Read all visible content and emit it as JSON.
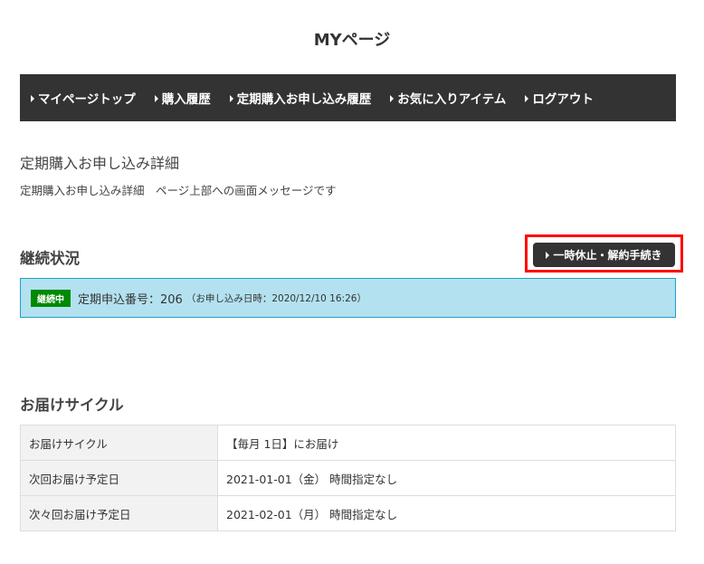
{
  "page_title": "MYページ",
  "nav": [
    "マイページトップ",
    "購入履歴",
    "定期購入お申し込み履歴",
    "お気に入りアイテム",
    "ログアウト"
  ],
  "heading": "定期購入お申し込み詳細",
  "message": "定期購入お申し込み詳細　ページ上部への画面メッセージです",
  "status_section": {
    "title": "継続状況",
    "button": "一時休止・解約手続き",
    "badge": "継続中",
    "order": "定期申込番号：206",
    "order_date": "（お申し込み日時：2020/12/10 16:26）"
  },
  "delivery": {
    "title": "お届けサイクル",
    "rows": [
      {
        "label": "お届けサイクル",
        "value": "【毎月 1日】にお届け"
      },
      {
        "label": "次回お届け予定日",
        "value": "2021-01-01（金） 時間指定なし"
      },
      {
        "label": "次々回お届け予定日",
        "value": "2021-02-01（月） 時間指定なし"
      }
    ]
  }
}
